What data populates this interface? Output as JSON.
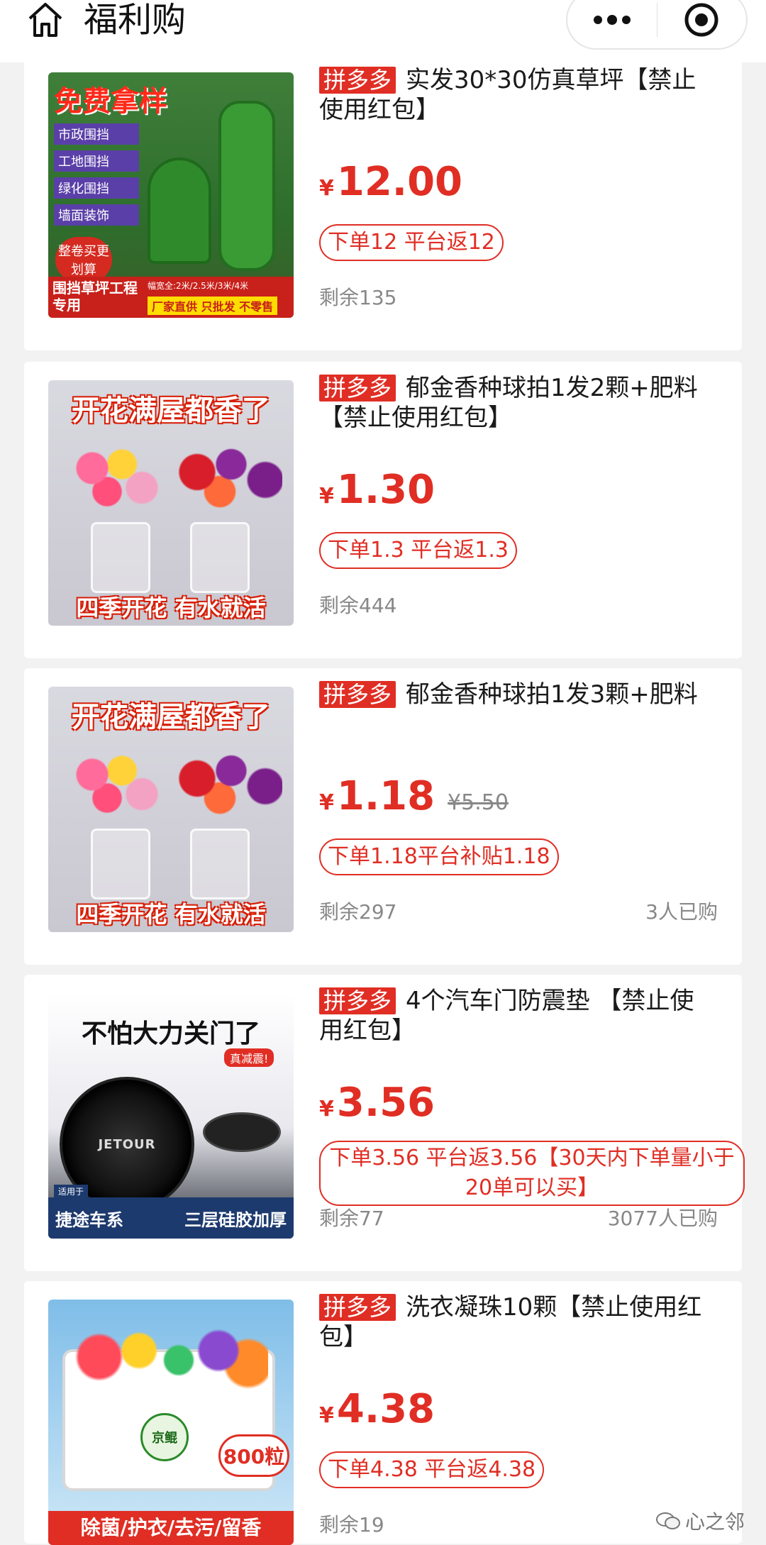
{
  "header": {
    "title": "福利购",
    "home_icon": "home-icon",
    "more_icon": "more-dots-icon",
    "close_icon": "target-icon"
  },
  "colors": {
    "accent": "#e02e24",
    "background": "#f2f2f2",
    "card": "#ffffff",
    "muted": "#888888"
  },
  "products": [
    {
      "platform": "拼多多",
      "title": "实发30*30仿真草坪【禁止使用红包】",
      "currency": "¥",
      "price": "12.00",
      "rebate": "下单12 平台返12",
      "stock": "剩余135",
      "image": {
        "top": "免费拿样",
        "tags": [
          "市政围挡",
          "工地围挡",
          "绿化围挡",
          "墙面装饰"
        ],
        "badge": "整卷买更划算",
        "bottom_left": "围挡草坪工程专用",
        "spec": "幅宽全:2米/2.5米/3米/4米",
        "footer": "厂家直供  只批发  不零售"
      }
    },
    {
      "platform": "拼多多",
      "title": "郁金香种球拍1发2颗+肥料【禁止使用红包】",
      "currency": "¥",
      "price": "1.30",
      "rebate": "下单1.3 平台返1.3",
      "stock": "剩余444",
      "image": {
        "top": "开花满屋都香了",
        "bottom": "四季开花  有水就活"
      }
    },
    {
      "platform": "拼多多",
      "title": "郁金香种球拍1发3颗+肥料",
      "currency": "¥",
      "price": "1.18",
      "original_price": "¥5.50",
      "rebate": "下单1.18平台补贴1.18",
      "stock": "剩余297",
      "bought": "3人已购",
      "image": {
        "top": "开花满屋都香了",
        "bottom": "四季开花  有水就活"
      }
    },
    {
      "platform": "拼多多",
      "title": "4个汽车门防震垫 【禁止使用红包】",
      "currency": "¥",
      "price": "3.56",
      "rebate": "下单3.56 平台返3.56【30天内下单量小于20单可以买】",
      "stock": "剩余77",
      "bought": "3077人已购",
      "image": {
        "top": "不怕大力关门了",
        "sub": "真减震!",
        "brand": "JETOUR",
        "tag": "适用于",
        "bottom_left": "捷途车系",
        "bottom_right": "三层硅胶加厚"
      }
    },
    {
      "platform": "拼多多",
      "title": "洗衣凝珠10颗【禁止使用红包】",
      "currency": "¥",
      "price": "4.38",
      "rebate": "下单4.38 平台返4.38",
      "stock": "剩余19",
      "image": {
        "count": "800粒",
        "brand": "京鲲",
        "bottom": "除菌/护衣/去污/留香"
      }
    }
  ],
  "watermark": "心之邻"
}
